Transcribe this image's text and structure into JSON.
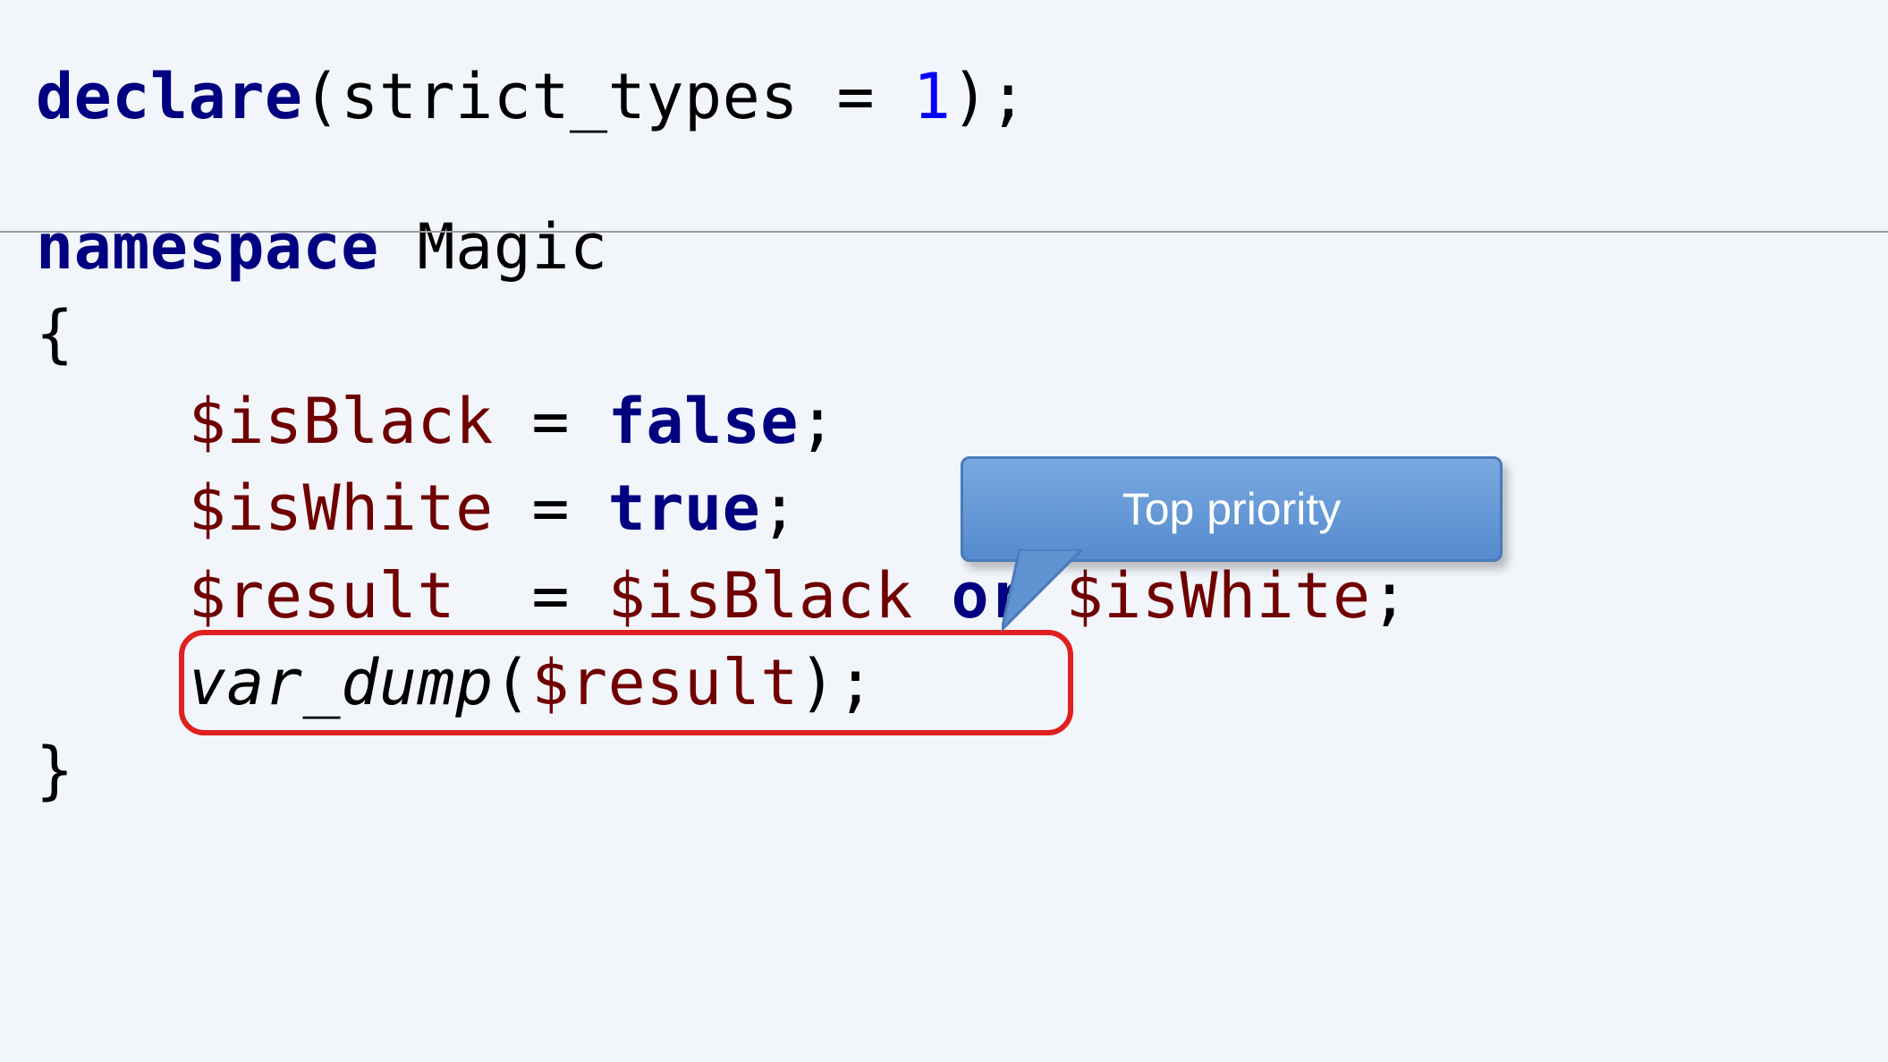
{
  "code": {
    "line1": {
      "kw_declare": "declare",
      "open_paren": "(",
      "ident_strict": "strict_types",
      "eq": " = ",
      "one": "1",
      "close": ");"
    },
    "line2": {
      "kw_namespace": "namespace",
      "nsname": " Magic"
    },
    "brace_open": "{",
    "line4": {
      "indent": "    ",
      "var_isBlack": "$isBlack",
      "eq": " = ",
      "kw_false": "false",
      "semi": ";"
    },
    "line5": {
      "indent": "    ",
      "var_isWhite": "$isWhite",
      "eq": " = ",
      "kw_true": "true",
      "semi": ";"
    },
    "line6": {
      "indent": "    ",
      "var_result": "$result",
      "gap": "  = ",
      "var_isBlack": "$isBlack",
      "space": " ",
      "kw_or": "or",
      "space2": " ",
      "var_isWhite": "$isWhite",
      "semi": ";"
    },
    "line7": {
      "indent": "    ",
      "fn_vardump": "var_dump",
      "open": "(",
      "var_result": "$result",
      "close": ");"
    },
    "brace_close": "}"
  },
  "callout": {
    "label": "Top priority"
  }
}
